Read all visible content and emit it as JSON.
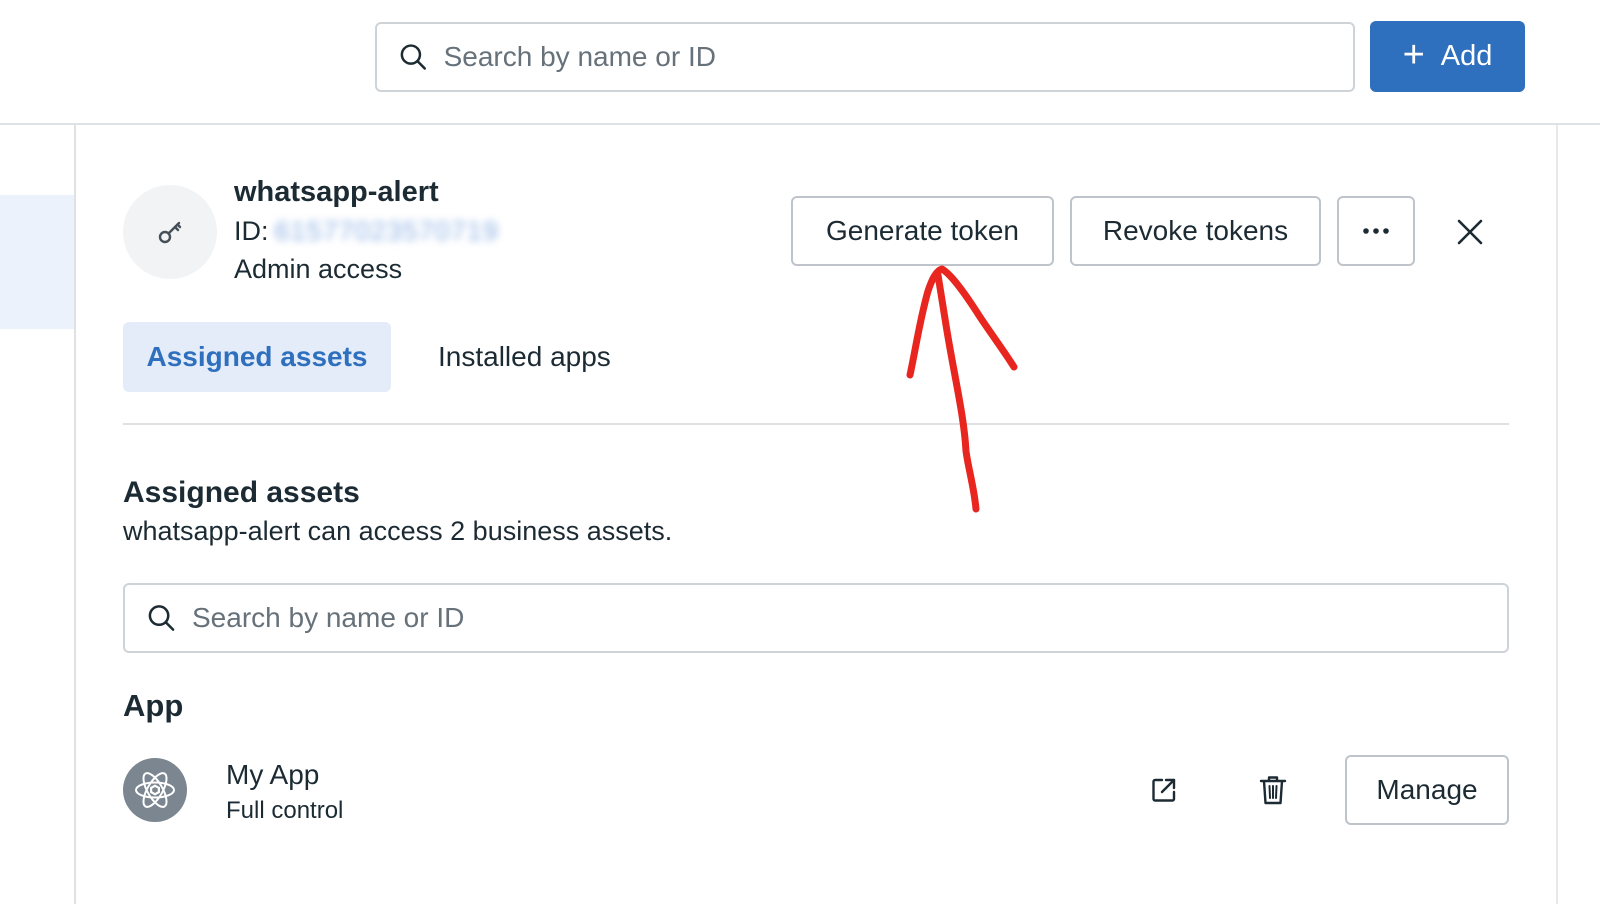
{
  "header": {
    "search_placeholder": "Search by name or ID",
    "add_label": "Add",
    "add_color": "#2e6fbe"
  },
  "profile": {
    "name": "whatsapp-alert",
    "id_label": "ID:",
    "id_value": "61577023570719",
    "access": "Admin access",
    "avatar_icon": "key-icon"
  },
  "actions": {
    "generate_token": "Generate token",
    "revoke_tokens": "Revoke tokens",
    "more": "•••",
    "close_icon": "close-icon"
  },
  "tabs": [
    {
      "label": "Assigned assets",
      "active": true
    },
    {
      "label": "Installed apps",
      "active": false
    }
  ],
  "assets": {
    "title": "Assigned assets",
    "description": "whatsapp-alert can access 2 business assets.",
    "search_placeholder": "Search by name or ID",
    "groups": [
      {
        "title": "App",
        "items": [
          {
            "name": "My App",
            "role": "Full control",
            "icon": "atom-app-icon",
            "manage_label": "Manage"
          }
        ]
      }
    ]
  },
  "annotation": {
    "color": "#e8261f",
    "shape": "arrow-pointing-up-at-generate-token"
  }
}
